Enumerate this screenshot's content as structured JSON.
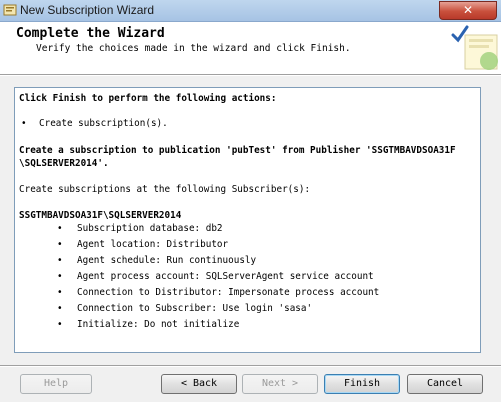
{
  "window": {
    "title": "New Subscription Wizard",
    "close_glyph": "✕"
  },
  "header": {
    "title": "Complete the Wizard",
    "subtitle": "Verify the choices made in the wizard and click Finish.",
    "icon": "wizard-checkmark-icon"
  },
  "summary": {
    "heading": "Click Finish to perform the following actions:",
    "action_bullet": "•",
    "action": "Create subscription(s).",
    "publication_line1": "Create a subscription to publication 'pubTest' from Publisher 'SSGTMBAVDSOA31F",
    "publication_line2": "\\SQLSERVER2014'.",
    "subscribers_intro": "Create subscriptions at the following Subscriber(s):",
    "subscriber": "SSGTMBAVDSOA31F\\SQLSERVER2014",
    "details": [
      "Subscription database: db2",
      "Agent location: Distributor",
      "Agent schedule: Run continuously",
      "Agent process account: SQLServerAgent service account",
      "Connection to Distributor: Impersonate process account",
      "Connection to Subscriber: Use login 'sasa'",
      "Initialize: Do not initialize"
    ]
  },
  "buttons": {
    "help": "Help",
    "back": "< Back",
    "next": "Next >",
    "finish": "Finish",
    "cancel": "Cancel"
  }
}
